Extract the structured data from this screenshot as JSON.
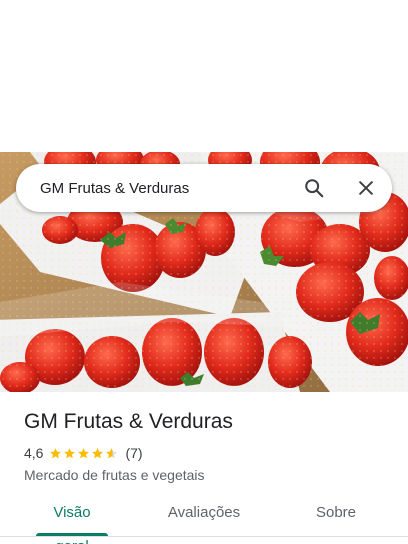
{
  "search": {
    "query": "GM Frutas & Verduras",
    "search_icon": "search-icon",
    "close_icon": "close-icon"
  },
  "place": {
    "name": "GM Frutas & Verduras",
    "rating": "4,6",
    "rating_value": 4.6,
    "review_count": "(7)",
    "category": "Mercado de frutas e vegetais"
  },
  "tabs": [
    {
      "label": "Visão geral",
      "active": true
    },
    {
      "label": "Avaliações",
      "active": false
    },
    {
      "label": "Sobre",
      "active": false
    }
  ],
  "colors": {
    "accent": "#0b7c66",
    "star": "#fbbc04",
    "strawberry": "#d8261c"
  }
}
